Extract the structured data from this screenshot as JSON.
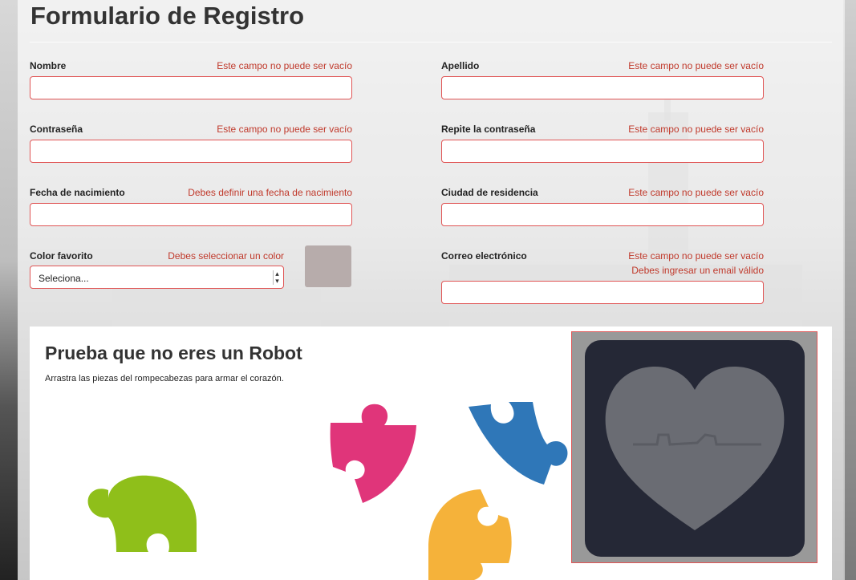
{
  "page": {
    "title": "Formulario de Registro"
  },
  "form": {
    "nombre": {
      "label": "Nombre",
      "error": "Este campo no puede ser vacío",
      "value": ""
    },
    "apellido": {
      "label": "Apellido",
      "error": "Este campo no puede ser vacío",
      "value": ""
    },
    "contrasena": {
      "label": "Contraseña",
      "error": "Este campo no puede ser vacío",
      "value": ""
    },
    "repite_contrasena": {
      "label": "Repite la contraseña",
      "error": "Este campo no puede ser vacío",
      "value": ""
    },
    "fecha_nacimiento": {
      "label": "Fecha de nacimiento",
      "error": "Debes definir una fecha de nacimiento",
      "value": ""
    },
    "ciudad": {
      "label": "Ciudad de residencia",
      "error": "Este campo no puede ser vacío",
      "value": ""
    },
    "color": {
      "label": "Color favorito",
      "error": "Debes seleccionar un color",
      "selected": "Seleciona...",
      "swatch_color": "#b7acab"
    },
    "correo": {
      "label": "Correo electrónico",
      "error": "Este campo no puede ser vacío",
      "error2": "Debes ingresar un email válido",
      "value": ""
    }
  },
  "captcha": {
    "title": "Prueba que no eres un Robot",
    "instructions": "Arrastra las piezas del rompecabezas para armar el corazón.",
    "pieces": [
      {
        "name": "pink-piece",
        "color": "#e0357a"
      },
      {
        "name": "blue-piece",
        "color": "#2f77b8"
      },
      {
        "name": "green-piece",
        "color": "#8fbf1a"
      },
      {
        "name": "orange-piece",
        "color": "#f5b23a"
      }
    ],
    "target": {
      "frame_color": "#999999",
      "board_color": "#252836",
      "heart_color": "#6a6c73"
    }
  },
  "colors": {
    "error": "#c0392b",
    "input_border": "#e05555"
  }
}
